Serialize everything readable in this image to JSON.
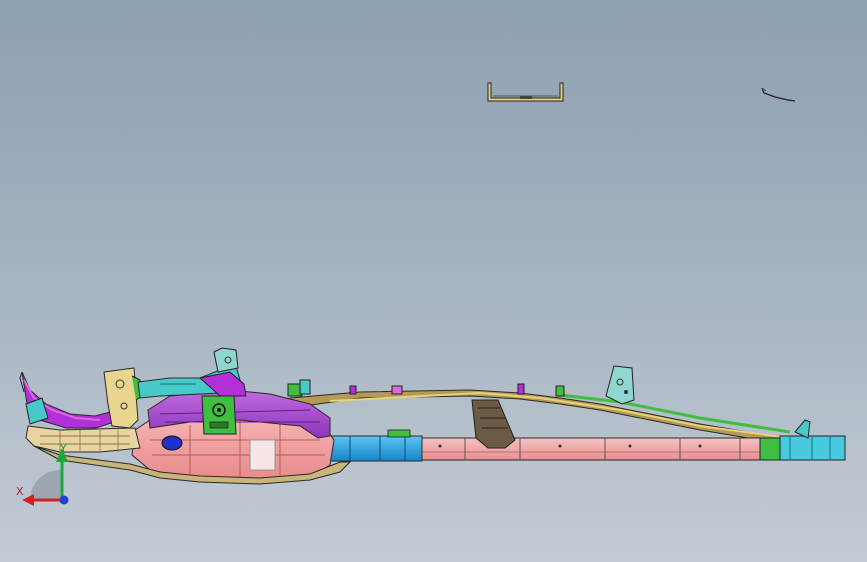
{
  "viewport": {
    "background_top": "#8d9fb2",
    "background_bottom": "#c3ccd5"
  },
  "model": {
    "parts": [
      "front-bumper-bracket",
      "front-crossmember",
      "front-frame-rail",
      "engine-cradle",
      "suspension-tower",
      "center-tunnel-rail",
      "side-sill-rail",
      "rear-frame-rail",
      "rear-crossmember",
      "rear-mount-bracket",
      "floating-channel-part",
      "floating-wire-part"
    ],
    "colors": {
      "magenta": "#b32fd8",
      "purple": "#7d3bb5",
      "salmon": "#f0a3a3",
      "blue": "#1ea4e8",
      "green": "#3fbf3f",
      "yellow": "#e8d27a",
      "cyan": "#47c9c9",
      "tan": "#d8c07a",
      "outline": "#2a2a2a"
    }
  },
  "triad": {
    "x_label": "X",
    "y_label": "Y",
    "x_color": "#d42020",
    "y_color": "#1aa83a",
    "z_color": "#2040d0"
  }
}
